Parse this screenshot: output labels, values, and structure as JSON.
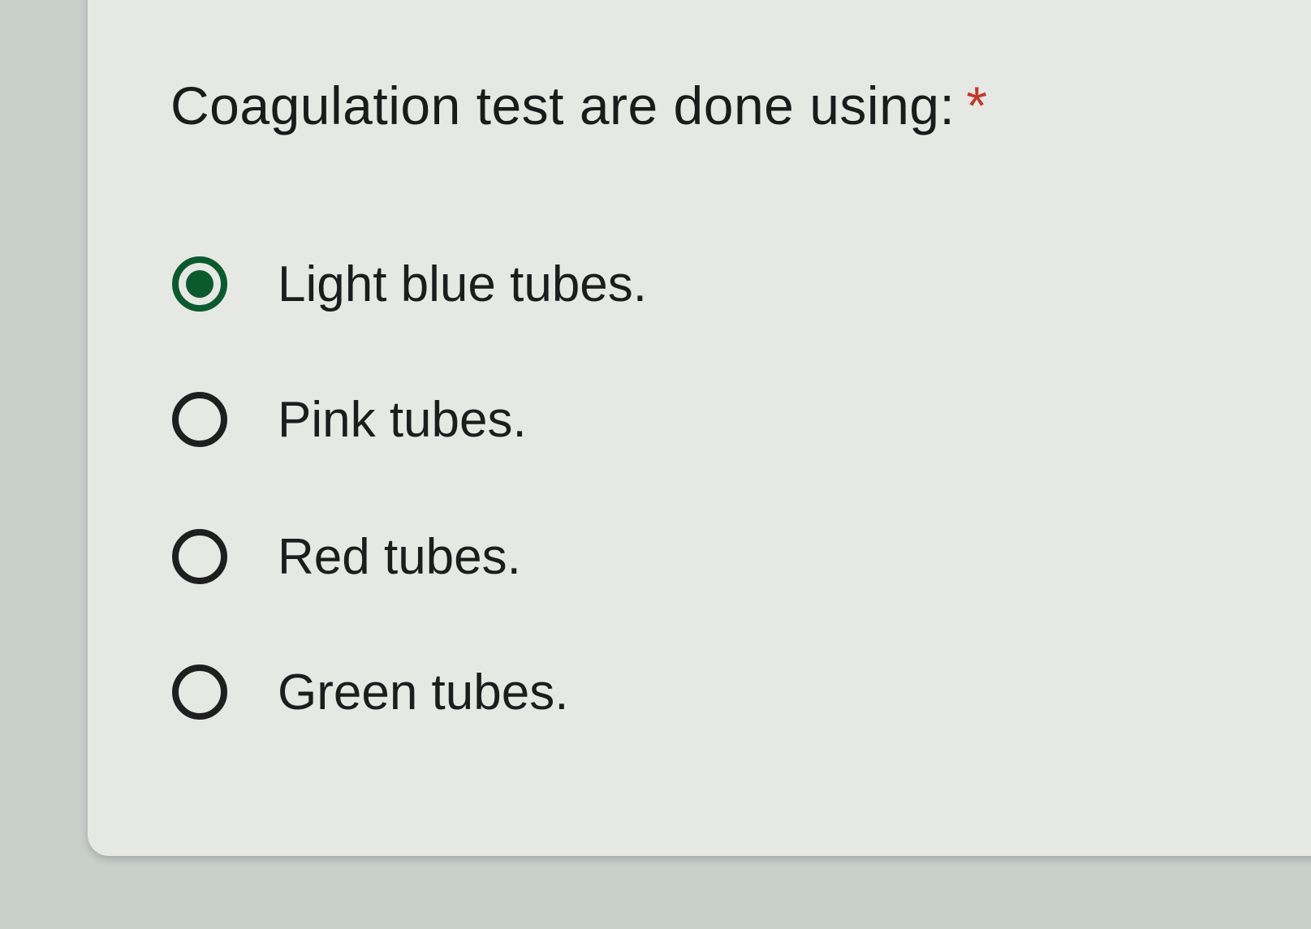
{
  "question": {
    "text": "Coagulation test are done using:",
    "required_marker": "*"
  },
  "options": [
    {
      "label": "Light blue tubes.",
      "selected": true
    },
    {
      "label": "Pink tubes.",
      "selected": false
    },
    {
      "label": "Red tubes.",
      "selected": false
    },
    {
      "label": "Green tubes.",
      "selected": false
    }
  ],
  "colors": {
    "selected_radio": "#0b5a2e",
    "required_marker": "#c0392b",
    "card_background": "#e6e8e4"
  }
}
